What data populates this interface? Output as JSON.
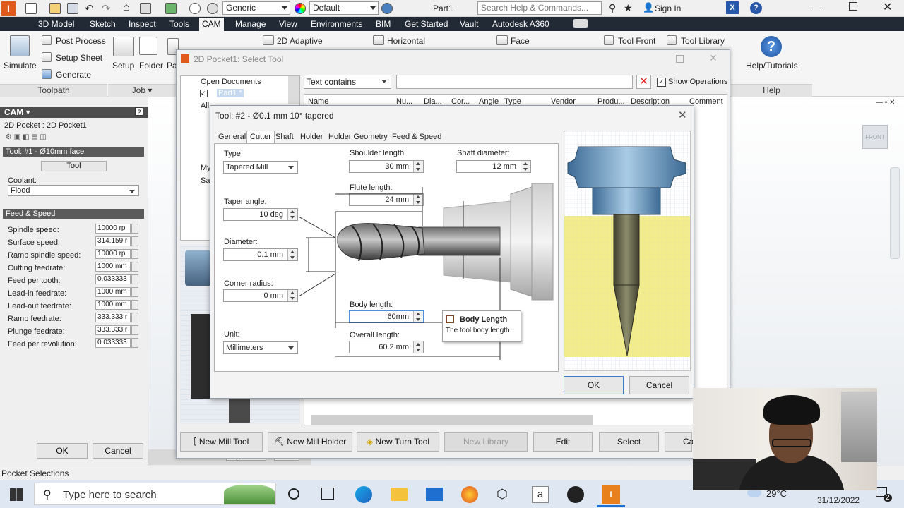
{
  "titlebar": {
    "appearance_combo": "Generic",
    "style_combo": "Default",
    "doc_title": "Part1",
    "search_placeholder": "Search Help & Commands...",
    "sign_in": "Sign In"
  },
  "ribbon_tabs": [
    "3D Model",
    "Sketch",
    "Inspect",
    "Tools",
    "CAM",
    "Manage",
    "View",
    "Environments",
    "BIM",
    "Get Started",
    "Vault",
    "Autodesk A360"
  ],
  "ribbon": {
    "simulate": "Simulate",
    "post_process": "Post Process",
    "setup_sheet": "Setup Sheet",
    "generate": "Generate",
    "setup": "Setup",
    "folder": "Folder",
    "pa": "Pa",
    "adaptive": "2D Adaptive",
    "horizontal": "Horizontal",
    "face": "Face",
    "tool_front": "Tool Front",
    "tool_library": "Tool Library",
    "help": "Help/Tutorials",
    "panel_toolpath": "Toolpath",
    "panel_job": "Job ▾",
    "panel_help": "Help"
  },
  "leftpanel": {
    "header": "CAM ▾",
    "op_name": "2D Pocket : 2D Pocket1",
    "tool_section": "Tool: #1 - Ø10mm face",
    "tool_button": "Tool",
    "coolant_label": "Coolant:",
    "coolant_value": "Flood",
    "feed_section": "Feed & Speed",
    "feed_rows": [
      {
        "label": "Spindle speed:",
        "value": "10000 rp"
      },
      {
        "label": "Surface speed:",
        "value": "314.159 r"
      },
      {
        "label": "Ramp spindle speed:",
        "value": "10000 rp"
      },
      {
        "label": "Cutting feedrate:",
        "value": "1000 mm"
      },
      {
        "label": "Feed per tooth:",
        "value": "0.033333"
      },
      {
        "label": "Lead-in feedrate:",
        "value": "1000 mm"
      },
      {
        "label": "Lead-out feedrate:",
        "value": "1000 mm"
      },
      {
        "label": "Ramp feedrate:",
        "value": "333.333 r"
      },
      {
        "label": "Plunge feedrate:",
        "value": "333.333 r"
      },
      {
        "label": "Feed per revolution:",
        "value": "0.033333"
      }
    ],
    "ok": "OK",
    "cancel": "Cancel"
  },
  "outer_dialog": {
    "title": "2D Pocket1: Select Tool",
    "tree": {
      "open_documents": "Open Documents",
      "part1": "Part1 *",
      "all": "All",
      "my": "My",
      "sar": "Sar"
    },
    "filter_mode": "Text contains",
    "filter_value": "",
    "show_operations": "Show Operations",
    "columns": [
      "Name",
      "Nu...",
      "Dia...",
      "Cor...",
      "Angle",
      "Type",
      "Vendor",
      "Produ...",
      "Description",
      "Comment"
    ],
    "buttons": {
      "new_mill_tool": "New Mill Tool",
      "new_mill_holder": "New Mill Holder",
      "new_turn_tool": "New Turn Tool",
      "new_library": "New Library",
      "edit": "Edit",
      "select": "Select",
      "cancel": "Ca"
    },
    "doc_tabs": [
      "My Home",
      "Part1"
    ]
  },
  "tool_dialog": {
    "title": "Tool: #2 - Ø0.1 mm 10° tapered",
    "tabs": [
      "General",
      "Cutter",
      "Shaft",
      "Holder",
      "Holder Geometry",
      "Feed & Speed"
    ],
    "active_tab": "Cutter",
    "type_label": "Type:",
    "type_value": "Tapered Mill",
    "taper_label": "Taper angle:",
    "taper_value": "10 deg",
    "diameter_label": "Diameter:",
    "diameter_value": "0.1 mm",
    "corner_label": "Corner radius:",
    "corner_value": "0 mm",
    "unit_label": "Unit:",
    "unit_value": "Millimeters",
    "shoulder_label": "Shoulder length:",
    "shoulder_value": "30 mm",
    "shaft_label": "Shaft diameter:",
    "shaft_value": "12 mm",
    "flute_label": "Flute length:",
    "flute_value": "24 mm",
    "body_label": "Body length:",
    "body_value": "60mm",
    "overall_label": "Overall length:",
    "overall_value": "60.2 mm",
    "tooltip_title": "Body Length",
    "tooltip_text": "The tool body length.",
    "ok": "OK",
    "cancel": "Cancel"
  },
  "statusbar": {
    "text": "Pocket Selections"
  },
  "taskbar": {
    "search_placeholder": "Type here to search",
    "temperature": "29°C",
    "date": "31/12/2022",
    "notifications": "2"
  },
  "viewcube": {
    "label": "FRONT"
  },
  "colors": {
    "ribbon_dark": "#222a35",
    "stock_yellow": "#f2ec8a",
    "accent_blue": "#2f6fb5"
  }
}
